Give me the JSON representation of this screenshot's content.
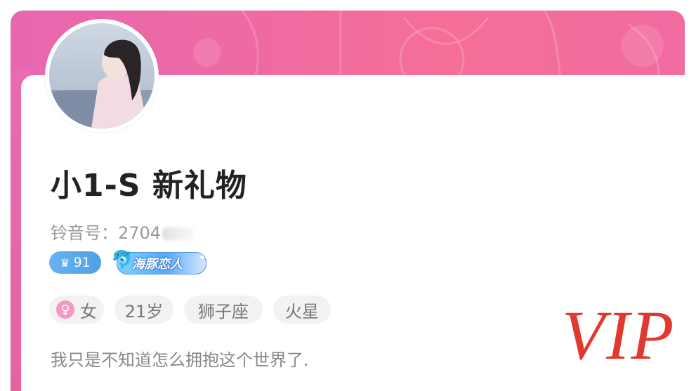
{
  "profile": {
    "nickname": "小1-S 新礼物",
    "uid_label": "铃音号：2704",
    "level": "91",
    "badge_name": "海豚恋人",
    "tags": {
      "gender": "女",
      "age": "21岁",
      "zodiac": "狮子座",
      "location": "火星"
    },
    "bio": "我只是不知道怎么拥抱这个世界了."
  },
  "watermark": "VIP",
  "icons": {
    "level": "crown-icon",
    "badge": "dolphin-icon",
    "gender": "female-icon"
  },
  "colors": {
    "banner_pink": "#f16aa0",
    "level_blue": "#4ea0e8",
    "watermark_red": "#e03a2f"
  }
}
